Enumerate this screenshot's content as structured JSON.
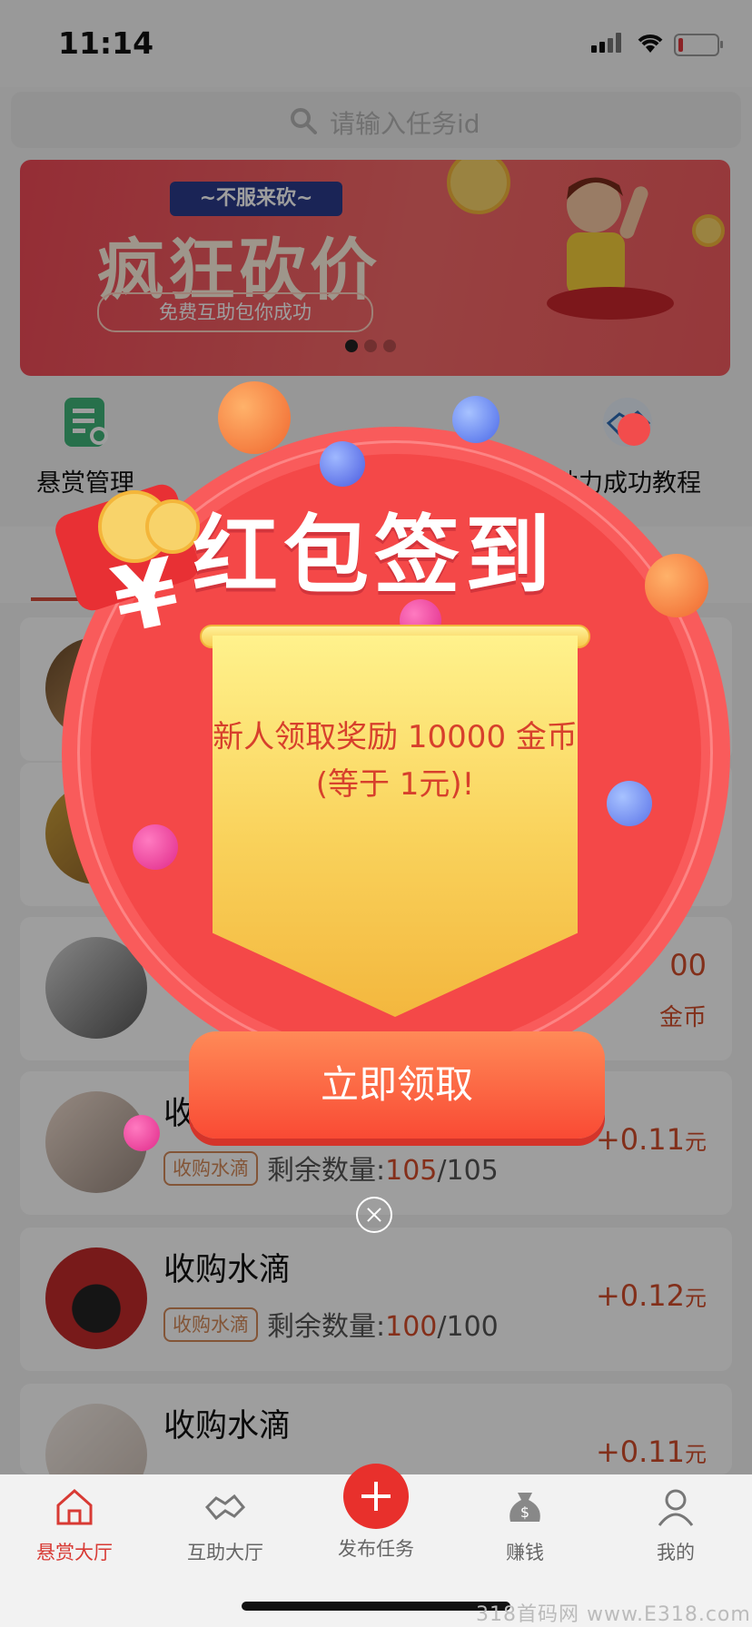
{
  "status_bar": {
    "time": "11:14"
  },
  "search": {
    "placeholder": "请输入任务id"
  },
  "banner": {
    "ribbon": "~不服来砍~",
    "title": "疯狂砍价",
    "subtitle": "免费互助包你成功",
    "page_count": 3,
    "active_page": 1
  },
  "quick_menu": {
    "items": [
      {
        "label": "悬赏管理",
        "icon": "clipboard-icon"
      },
      {
        "label": "助力成功教程",
        "icon": "handshake-icon"
      }
    ]
  },
  "tasks": [
    {
      "title": "",
      "reward_value": "00",
      "reward_unit": "金币"
    },
    {
      "title": "收购水滴",
      "tag": "收购水滴",
      "remaining_label": "剩余数量:",
      "remaining_current": "105",
      "remaining_total": "/105",
      "reward_value": "+0.11",
      "reward_unit": "元"
    },
    {
      "title": "收购水滴",
      "tag": "收购水滴",
      "remaining_label": "剩余数量:",
      "remaining_current": "100",
      "remaining_total": "/100",
      "reward_value": "+0.12",
      "reward_unit": "元"
    },
    {
      "title": "收购水滴",
      "tag": "收购水滴",
      "reward_value": "+0.11",
      "reward_unit": "元"
    }
  ],
  "popup": {
    "title": "红包签到",
    "message": "新人领取奖励 10000 金币 (等于 1元)!",
    "button": "立即领取",
    "colors": {
      "primary": "#f44848",
      "scroll": "#f9d15a",
      "button": "#f94a34",
      "message": "#d7402c"
    }
  },
  "tab_bar": {
    "items": [
      {
        "label": "悬赏大厅",
        "icon": "home-icon",
        "active": true
      },
      {
        "label": "互助大厅",
        "icon": "handshake-icon",
        "active": false
      },
      {
        "label": "发布任务",
        "icon": "plus-icon",
        "active": false
      },
      {
        "label": "赚钱",
        "icon": "money-bag-icon",
        "active": false
      },
      {
        "label": "我的",
        "icon": "user-icon",
        "active": false
      }
    ],
    "accent": "#d83a34"
  },
  "watermark": "318首码网 www.E318.com"
}
